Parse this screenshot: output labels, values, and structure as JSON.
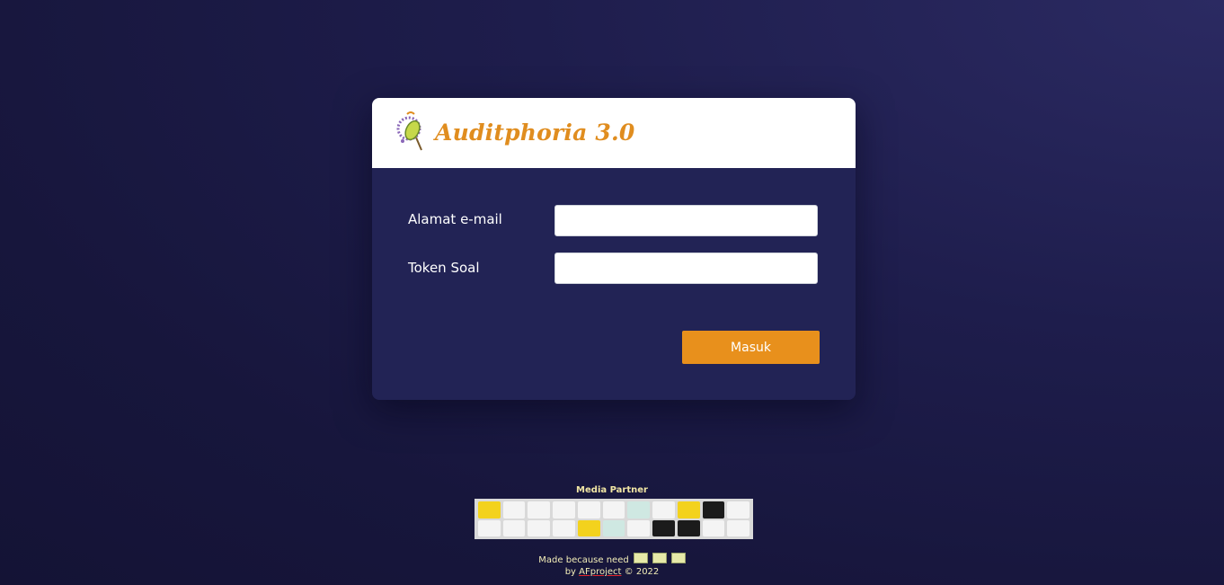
{
  "header": {
    "brand": "Auditphoria 3.0"
  },
  "form": {
    "email_label": "Alamat e-mail",
    "email_value": "",
    "token_label": "Token Soal",
    "token_value": "",
    "submit_label": "Masuk"
  },
  "footer": {
    "partner_title": "Media Partner",
    "partner_logos": [
      "",
      "",
      "",
      "",
      "",
      "",
      "",
      "",
      "",
      "",
      "",
      "",
      "",
      "",
      "",
      "",
      "",
      "",
      "",
      "",
      "",
      ""
    ],
    "made_text": "Made because need",
    "emojis": [
      "",
      "",
      ""
    ],
    "by_prefix": "by",
    "author": "AFproject",
    "copyright": "© 2022"
  },
  "colors": {
    "accent": "#e8901c",
    "card_bg": "#222355",
    "brand_text": "#e08d1f"
  }
}
